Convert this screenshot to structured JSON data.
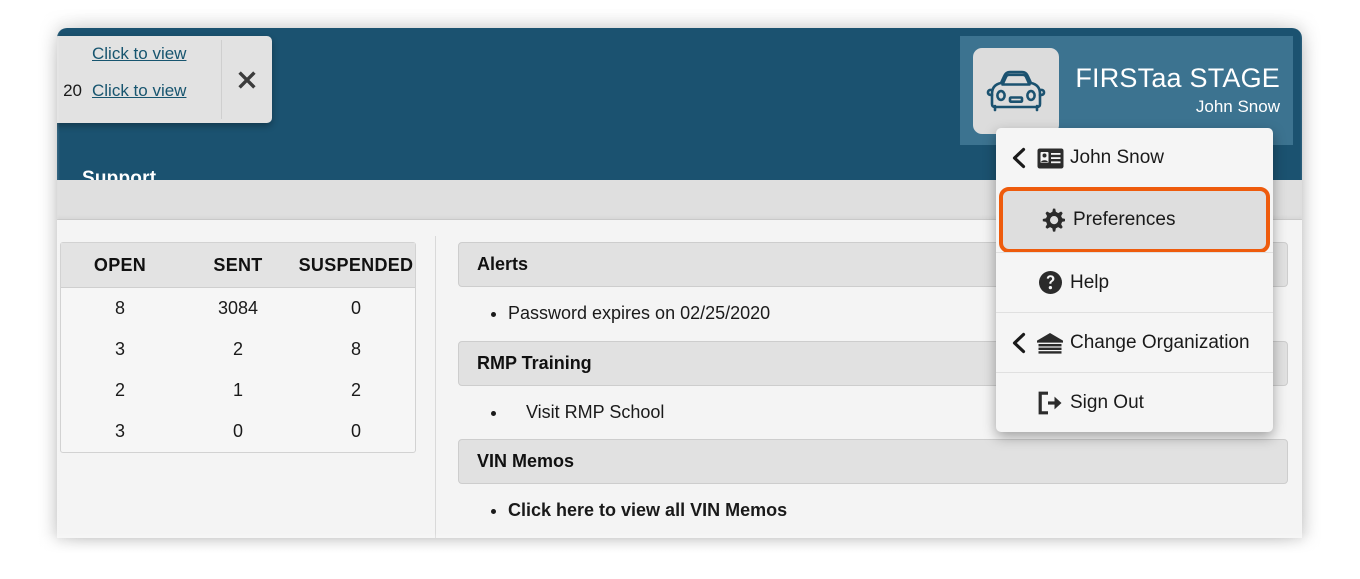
{
  "brand": {
    "title": "FIRSTaa STAGE",
    "user": "John Snow",
    "logo_icon": "car-icon"
  },
  "navbar": {
    "support_label": "Support",
    "background_color": "#1b5270"
  },
  "notification_popup": {
    "rows": [
      {
        "date": "",
        "link_label": "Click to view"
      },
      {
        "date": "20",
        "link_label": "Click to view"
      }
    ],
    "close_icon": "close-icon",
    "link_color": "#17556f"
  },
  "stats": {
    "columns": [
      "OPEN",
      "SENT",
      "SUSPENDED"
    ],
    "rows": [
      [
        "8",
        "3084",
        "0"
      ],
      [
        "3",
        "2",
        "8"
      ],
      [
        "2",
        "1",
        "2"
      ],
      [
        "3",
        "0",
        "0"
      ]
    ]
  },
  "panels": [
    {
      "title": "Alerts",
      "items": [
        {
          "text": "Password expires on 02/25/2020",
          "bold": false,
          "indented": false
        }
      ]
    },
    {
      "title": "RMP Training",
      "items": [
        {
          "text": "Visit RMP School",
          "bold": false,
          "indented": true
        }
      ]
    },
    {
      "title": "VIN Memos",
      "items": [
        {
          "text": "Click here to view all VIN Memos",
          "bold": true,
          "indented": false
        }
      ]
    }
  ],
  "user_menu": {
    "highlight_color": "#ee5b0c",
    "items": [
      {
        "label": "John Snow",
        "icon": "id-card-icon",
        "chevron": true,
        "highlighted": false
      },
      {
        "label": "Preferences",
        "icon": "gear-icon",
        "chevron": false,
        "highlighted": true
      },
      {
        "label": "Help",
        "icon": "question-circle-icon",
        "chevron": false,
        "highlighted": false
      },
      {
        "label": "Change Organization",
        "icon": "building-icon",
        "chevron": true,
        "highlighted": false
      },
      {
        "label": "Sign Out",
        "icon": "sign-out-icon",
        "chevron": false,
        "highlighted": false
      }
    ]
  }
}
